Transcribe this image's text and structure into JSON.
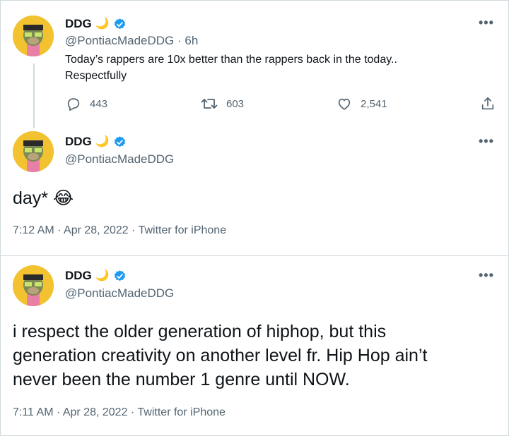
{
  "tweet1": {
    "name": "DDG",
    "moon": "🌙",
    "handle": "@PontiacMadeDDG",
    "time_ago": "· 6h",
    "text_line1": "Today’s rappers are 10x better than the rappers back in the today..",
    "text_line2": "Respectfully",
    "replies": "443",
    "retweets": "603",
    "likes": "2,541"
  },
  "tweet2": {
    "name": "DDG",
    "moon": "🌙",
    "handle": "@PontiacMadeDDG",
    "text": "day* 😂",
    "meta": "7:12 AM · Apr 28, 2022 · Twitter for iPhone"
  },
  "tweet3": {
    "name": "DDG",
    "moon": "🌙",
    "handle": "@PontiacMadeDDG",
    "text_line1": "i respect the older generation of hiphop, but this",
    "text_line2": "generation creativity on another level fr. Hip Hop ain’t",
    "text_line3": "never been the number 1 genre until NOW.",
    "meta": "7:11 AM · Apr 28, 2022 · Twitter for iPhone"
  },
  "more_glyph": "•••",
  "colors": {
    "verified": "#1d9bf0",
    "secondary": "#536471",
    "border": "#cfd9de",
    "avatar_bg": "#f2c230"
  }
}
